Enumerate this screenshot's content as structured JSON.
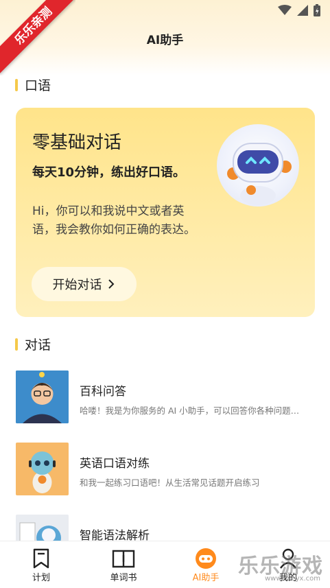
{
  "header": {
    "title": "AI助手",
    "ribbon": "乐乐亲测"
  },
  "sections": {
    "speaking": "口语",
    "dialogue": "对话"
  },
  "card": {
    "title": "零基础对话",
    "subtitle_prefix": "每天",
    "subtitle_num": "10",
    "subtitle_suffix": "分钟，练出好口语。",
    "description": "Hi，你可以和我说中文或者英语，我会教你如何正确的表达。",
    "button_label": "开始对话"
  },
  "list": [
    {
      "title": "百科问答",
      "desc": "哈喽！我是为你服务的 AI 小助手，可以回答你各种问题…"
    },
    {
      "title": "英语口语对练",
      "desc": "和我一起练习口语吧！从生活常见话题开启练习"
    },
    {
      "title": "智能语法解析",
      "desc": ""
    }
  ],
  "tabs": [
    {
      "label": "计划",
      "icon": "bookmark-icon"
    },
    {
      "label": "单词书",
      "icon": "book-icon"
    },
    {
      "label": "AI助手",
      "icon": "robot-icon"
    },
    {
      "label": "我的",
      "icon": "person-icon"
    }
  ],
  "watermark": {
    "text": "乐乐游戏",
    "url": "www.leleyx.com"
  },
  "colors": {
    "accent": "#ff8a1c",
    "card_bg": "#ffe48a",
    "section_bar": "#f5c94a",
    "ribbon": "#e0262c"
  }
}
